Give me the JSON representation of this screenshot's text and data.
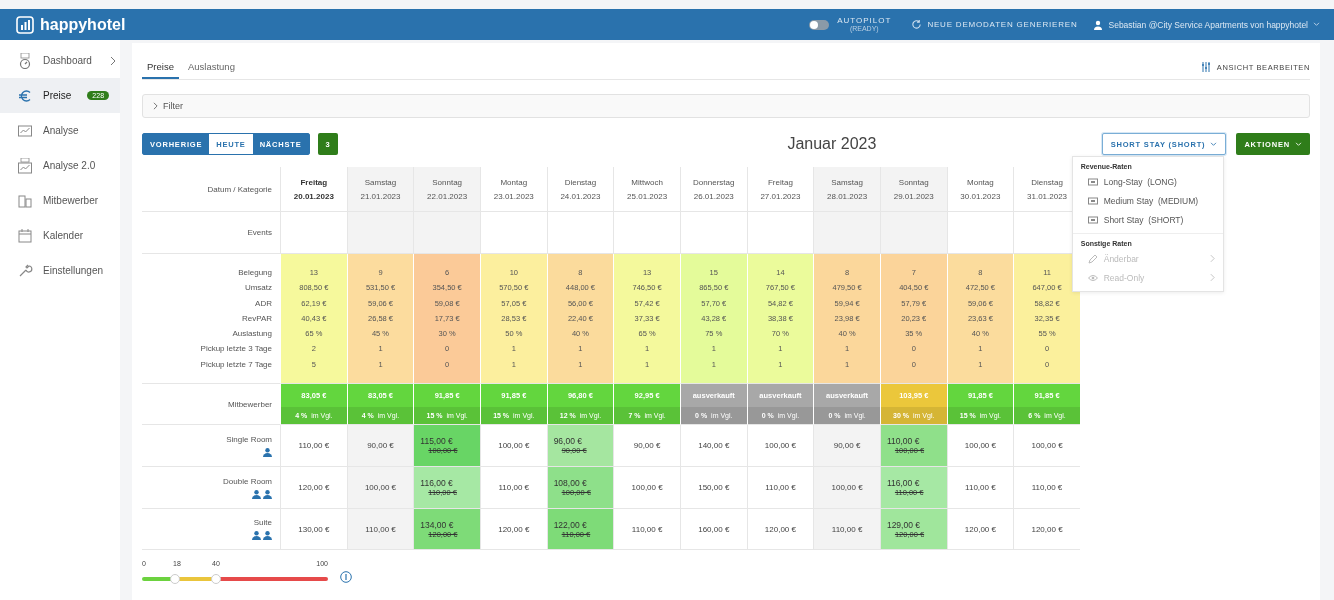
{
  "header": {
    "brand": "happyhotel",
    "autopilot": {
      "label": "AUTOPILOT",
      "status": "(READY)",
      "on": false
    },
    "demo_button": "NEUE DEMODATEN GENERIEREN",
    "user": "Sebastian @City Service Apartments von happyhotel"
  },
  "sidebar": {
    "items": [
      {
        "label": "Dashboard",
        "selected": false,
        "chevron": true
      },
      {
        "label": "Preise",
        "selected": true,
        "badge": "228"
      },
      {
        "label": "Analyse",
        "selected": false
      },
      {
        "label": "Analyse 2.0",
        "selected": false
      },
      {
        "label": "Mitbewerber",
        "selected": false
      },
      {
        "label": "Kalender",
        "selected": false
      },
      {
        "label": "Einstellungen",
        "selected": false
      }
    ]
  },
  "tabs": [
    {
      "label": "Preise",
      "selected": true
    },
    {
      "label": "Auslastung",
      "selected": false
    }
  ],
  "edit_view": "ANSICHT BEARBEITEN",
  "filter": "Filter",
  "nav": [
    {
      "label": "VORHERIGE",
      "selected": false
    },
    {
      "label": "HEUTE",
      "selected": true
    },
    {
      "label": "NÄCHSTE",
      "selected": false
    }
  ],
  "count_badge": "3",
  "month": "Januar 2023",
  "rate_select": {
    "label": "SHORT STAY (SHORT)",
    "expanded": true
  },
  "actions": "AKTIONEN",
  "rate_menu": [
    {
      "heading": "Revenue-Raten",
      "items": [
        {
          "label": "Long-Stay  (LONG)",
          "kind": "rate",
          "disabled": false
        },
        {
          "label": "Medium Stay  (MEDIUM)",
          "kind": "rate",
          "disabled": false
        },
        {
          "label": "Short Stay  (SHORT)",
          "kind": "rate",
          "disabled": false
        }
      ]
    },
    {
      "heading": "Sonstige Raten",
      "items": [
        {
          "label": "Änderbar",
          "kind": "editable",
          "disabled": true
        },
        {
          "label": "Read-Only",
          "kind": "readonly",
          "disabled": true
        }
      ]
    }
  ],
  "table": {
    "corner": "Datum / Kategorie",
    "events_label": "Events",
    "competitor_label": "Mitbewerber",
    "metric_labels": [
      "Belegung",
      "Umsatz",
      "ADR",
      "RevPAR",
      "Auslastung",
      "Pickup letzte 3 Tage",
      "Pickup letzte 7 Tage"
    ],
    "days": [
      {
        "weekday": "Freitag",
        "date": "20.01.2023",
        "today": true,
        "weekend": false,
        "color": "#f6f99c",
        "metrics": [
          "13",
          "808,50 €",
          "62,19 €",
          "40,43 €",
          "65 %",
          "2",
          "5"
        ],
        "competitor": {
          "price": "83,05 €",
          "compare": "**4 %** im Vgl.",
          "color": "#63d63e"
        }
      },
      {
        "weekday": "Samstag",
        "date": "21.01.2023",
        "today": false,
        "weekend": true,
        "color": "#fcdc9e",
        "metrics": [
          "9",
          "531,50 €",
          "59,06 €",
          "26,58 €",
          "45 %",
          "1",
          "1"
        ],
        "competitor": {
          "price": "83,05 €",
          "compare": "**4 %** im Vgl.",
          "color": "#63d63e"
        }
      },
      {
        "weekday": "Sonntag",
        "date": "22.01.2023",
        "today": false,
        "weekend": true,
        "color": "#fbca98",
        "metrics": [
          "6",
          "354,50 €",
          "59,08 €",
          "17,73 €",
          "30 %",
          "0",
          "0"
        ],
        "competitor": {
          "price": "91,85 €",
          "compare": "**15 %** im Vgl.",
          "color": "#63d63e"
        }
      },
      {
        "weekday": "Montag",
        "date": "23.01.2023",
        "today": false,
        "weekend": false,
        "color": "#fcef9e",
        "metrics": [
          "10",
          "570,50 €",
          "57,05 €",
          "28,53 €",
          "50 %",
          "1",
          "1"
        ],
        "competitor": {
          "price": "91,85 €",
          "compare": "**15 %** im Vgl.",
          "color": "#63d63e"
        }
      },
      {
        "weekday": "Dienstag",
        "date": "24.01.2023",
        "today": false,
        "weekend": false,
        "color": "#fbdb9c",
        "metrics": [
          "8",
          "448,00 €",
          "56,00 €",
          "22,40 €",
          "40 %",
          "1",
          "1"
        ],
        "competitor": {
          "price": "96,80 €",
          "compare": "**12 %** im Vgl.",
          "color": "#63d63e"
        }
      },
      {
        "weekday": "Mittwoch",
        "date": "25.01.2023",
        "today": false,
        "weekend": false,
        "color": "#f4f99c",
        "metrics": [
          "13",
          "746,50 €",
          "57,42 €",
          "37,33 €",
          "65 %",
          "1",
          "1"
        ],
        "competitor": {
          "price": "92,95 €",
          "compare": "**7 %** im Vgl.",
          "color": "#63d63e"
        }
      },
      {
        "weekday": "Donnerstag",
        "date": "26.01.2023",
        "today": false,
        "weekend": false,
        "color": "#e4fb9a",
        "metrics": [
          "15",
          "865,50 €",
          "57,70 €",
          "43,28 €",
          "75 %",
          "1",
          "1"
        ],
        "competitor": {
          "price": "ausverkauft",
          "compare": "**0 %** im Vgl.",
          "color": "#a8a8a8"
        }
      },
      {
        "weekday": "Freitag",
        "date": "27.01.2023",
        "today": false,
        "weekend": false,
        "color": "#ebfb9b",
        "metrics": [
          "14",
          "767,50 €",
          "54,82 €",
          "38,38 €",
          "70 %",
          "1",
          "1"
        ],
        "competitor": {
          "price": "ausverkauft",
          "compare": "**0 %** im Vgl.",
          "color": "#a8a8a8"
        }
      },
      {
        "weekday": "Samstag",
        "date": "28.01.2023",
        "today": false,
        "weekend": true,
        "color": "#fbd79b",
        "metrics": [
          "8",
          "479,50 €",
          "59,94 €",
          "23,98 €",
          "40 %",
          "1",
          "1"
        ],
        "competitor": {
          "price": "ausverkauft",
          "compare": "**0 %** im Vgl.",
          "color": "#a8a8a8"
        }
      },
      {
        "weekday": "Sonntag",
        "date": "29.01.2023",
        "today": false,
        "weekend": true,
        "color": "#fbd49a",
        "metrics": [
          "7",
          "404,50 €",
          "57,79 €",
          "20,23 €",
          "35 %",
          "0",
          "0"
        ],
        "competitor": {
          "price": "103,95 €",
          "compare": "**30 %** im Vgl.",
          "color": "#ebc73b"
        }
      },
      {
        "weekday": "Montag",
        "date": "30.01.2023",
        "today": false,
        "weekend": false,
        "color": "#fbdc9d",
        "metrics": [
          "8",
          "472,50 €",
          "59,06 €",
          "23,63 €",
          "40 %",
          "1",
          "1"
        ],
        "competitor": {
          "price": "91,85 €",
          "compare": "**15 %** im Vgl.",
          "color": "#63d63e"
        }
      },
      {
        "weekday": "Dienstag",
        "date": "31.01.2023",
        "today": false,
        "weekend": false,
        "color": "#fbf09c",
        "metrics": [
          "11",
          "647,00 €",
          "58,82 €",
          "32,35 €",
          "55 %",
          "0",
          "0"
        ],
        "competitor": {
          "price": "91,85 €",
          "compare": "**6 %** im Vgl.",
          "color": "#63d63e"
        }
      }
    ],
    "rooms": [
      {
        "name": "Single Room",
        "kind": "single",
        "cells": [
          {
            "price": "110,00 €"
          },
          {
            "price": "90,00 €"
          },
          {
            "price": "115,00 €",
            "old": "100,00 €",
            "color": "#68d565"
          },
          {
            "price": "100,00 €"
          },
          {
            "price": "96,00 €",
            "old": "90,00 €",
            "color": "#a5e6a0"
          },
          {
            "price": "90,00 €"
          },
          {
            "price": "140,00 €"
          },
          {
            "price": "100,00 €"
          },
          {
            "price": "90,00 €"
          },
          {
            "price": "110,00 €",
            "old": "100,00 €",
            "color": "#8fe08a"
          },
          {
            "price": "100,00 €"
          },
          {
            "price": "100,00 €"
          }
        ]
      },
      {
        "name": "Double Room",
        "kind": "double",
        "cells": [
          {
            "price": "120,00 €"
          },
          {
            "price": "100,00 €"
          },
          {
            "price": "116,00 €",
            "old": "110,00 €",
            "color": "#a6e8a4"
          },
          {
            "price": "110,00 €"
          },
          {
            "price": "108,00 €",
            "old": "100,00 €",
            "color": "#8ee08a"
          },
          {
            "price": "100,00 €"
          },
          {
            "price": "150,00 €"
          },
          {
            "price": "110,00 €"
          },
          {
            "price": "100,00 €"
          },
          {
            "price": "116,00 €",
            "old": "110,00 €",
            "color": "#a6e8a4"
          },
          {
            "price": "110,00 €"
          },
          {
            "price": "110,00 €"
          }
        ]
      },
      {
        "name": "Suite",
        "kind": "double",
        "cells": [
          {
            "price": "130,00 €"
          },
          {
            "price": "110,00 €"
          },
          {
            "price": "134,00 €",
            "old": "120,00 €",
            "color": "#7edb78"
          },
          {
            "price": "120,00 €"
          },
          {
            "price": "122,00 €",
            "old": "110,00 €",
            "color": "#7edb78"
          },
          {
            "price": "110,00 €"
          },
          {
            "price": "160,00 €"
          },
          {
            "price": "120,00 €"
          },
          {
            "price": "110,00 €"
          },
          {
            "price": "129,00 €",
            "old": "120,00 €",
            "color": "#a0e69c"
          },
          {
            "price": "120,00 €"
          },
          {
            "price": "120,00 €"
          }
        ]
      }
    ]
  },
  "legend": {
    "ticks": [
      "0",
      "18",
      "40",
      "100"
    ],
    "thumbs": [
      {
        "level": 0.18
      },
      {
        "level": 0.4
      }
    ]
  }
}
